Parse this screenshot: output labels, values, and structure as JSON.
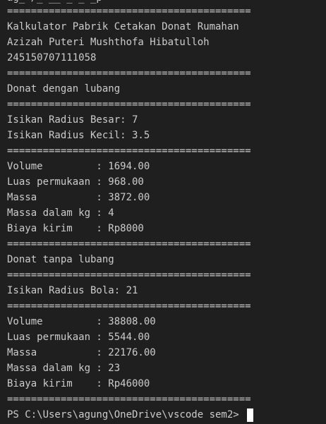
{
  "terminal": {
    "top_partial": "ag_ /_ __ _ _ _p",
    "lines": [
      "=========================================",
      "Kalkulator Pabrik Cetakan Donat Rumahan",
      "Azizah Puteri Mushthofa Hibatulloh",
      "245150707111058",
      "=========================================",
      "Donat dengan lubang",
      "=========================================",
      "Isikan Radius Besar: 7",
      "Isikan Radius Kecil: 3.5",
      "=========================================",
      "Volume         : 1694.00",
      "Luas permukaan : 968.00",
      "Massa          : 3872.00",
      "Massa dalam kg : 4",
      "Biaya kirim    : Rp8000",
      "=========================================",
      "Donat tanpa lubang",
      "=========================================",
      "Isikan Radius Bola: 21",
      "=========================================",
      "Volume         : 38808.00",
      "Luas permukaan : 5544.00",
      "Massa          : 22176.00",
      "Massa dalam kg : 23",
      "Biaya kirim    : Rp46000",
      "========================================="
    ],
    "prompt": "PS C:\\Users\\agung\\OneDrive\\vscode sem2> "
  }
}
